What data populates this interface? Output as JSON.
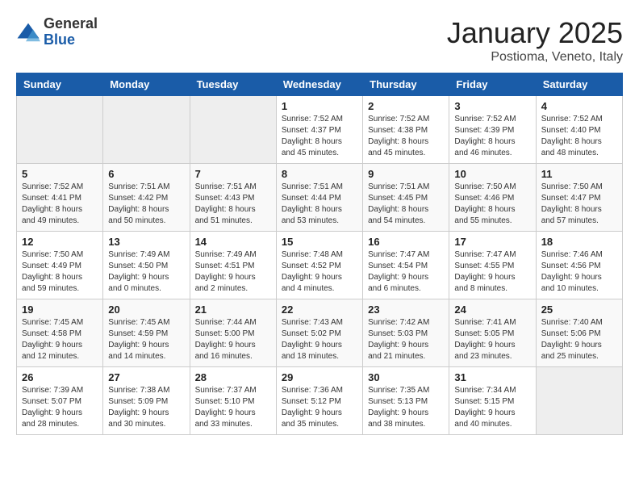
{
  "logo": {
    "general": "General",
    "blue": "Blue"
  },
  "header": {
    "title": "January 2025",
    "subtitle": "Postioma, Veneto, Italy"
  },
  "weekdays": [
    "Sunday",
    "Monday",
    "Tuesday",
    "Wednesday",
    "Thursday",
    "Friday",
    "Saturday"
  ],
  "weeks": [
    [
      {
        "day": "",
        "empty": true
      },
      {
        "day": "",
        "empty": true
      },
      {
        "day": "",
        "empty": true
      },
      {
        "day": "1",
        "sunrise": "Sunrise: 7:52 AM",
        "sunset": "Sunset: 4:37 PM",
        "daylight": "Daylight: 8 hours and 45 minutes."
      },
      {
        "day": "2",
        "sunrise": "Sunrise: 7:52 AM",
        "sunset": "Sunset: 4:38 PM",
        "daylight": "Daylight: 8 hours and 45 minutes."
      },
      {
        "day": "3",
        "sunrise": "Sunrise: 7:52 AM",
        "sunset": "Sunset: 4:39 PM",
        "daylight": "Daylight: 8 hours and 46 minutes."
      },
      {
        "day": "4",
        "sunrise": "Sunrise: 7:52 AM",
        "sunset": "Sunset: 4:40 PM",
        "daylight": "Daylight: 8 hours and 48 minutes."
      }
    ],
    [
      {
        "day": "5",
        "sunrise": "Sunrise: 7:52 AM",
        "sunset": "Sunset: 4:41 PM",
        "daylight": "Daylight: 8 hours and 49 minutes."
      },
      {
        "day": "6",
        "sunrise": "Sunrise: 7:51 AM",
        "sunset": "Sunset: 4:42 PM",
        "daylight": "Daylight: 8 hours and 50 minutes."
      },
      {
        "day": "7",
        "sunrise": "Sunrise: 7:51 AM",
        "sunset": "Sunset: 4:43 PM",
        "daylight": "Daylight: 8 hours and 51 minutes."
      },
      {
        "day": "8",
        "sunrise": "Sunrise: 7:51 AM",
        "sunset": "Sunset: 4:44 PM",
        "daylight": "Daylight: 8 hours and 53 minutes."
      },
      {
        "day": "9",
        "sunrise": "Sunrise: 7:51 AM",
        "sunset": "Sunset: 4:45 PM",
        "daylight": "Daylight: 8 hours and 54 minutes."
      },
      {
        "day": "10",
        "sunrise": "Sunrise: 7:50 AM",
        "sunset": "Sunset: 4:46 PM",
        "daylight": "Daylight: 8 hours and 55 minutes."
      },
      {
        "day": "11",
        "sunrise": "Sunrise: 7:50 AM",
        "sunset": "Sunset: 4:47 PM",
        "daylight": "Daylight: 8 hours and 57 minutes."
      }
    ],
    [
      {
        "day": "12",
        "sunrise": "Sunrise: 7:50 AM",
        "sunset": "Sunset: 4:49 PM",
        "daylight": "Daylight: 8 hours and 59 minutes."
      },
      {
        "day": "13",
        "sunrise": "Sunrise: 7:49 AM",
        "sunset": "Sunset: 4:50 PM",
        "daylight": "Daylight: 9 hours and 0 minutes."
      },
      {
        "day": "14",
        "sunrise": "Sunrise: 7:49 AM",
        "sunset": "Sunset: 4:51 PM",
        "daylight": "Daylight: 9 hours and 2 minutes."
      },
      {
        "day": "15",
        "sunrise": "Sunrise: 7:48 AM",
        "sunset": "Sunset: 4:52 PM",
        "daylight": "Daylight: 9 hours and 4 minutes."
      },
      {
        "day": "16",
        "sunrise": "Sunrise: 7:47 AM",
        "sunset": "Sunset: 4:54 PM",
        "daylight": "Daylight: 9 hours and 6 minutes."
      },
      {
        "day": "17",
        "sunrise": "Sunrise: 7:47 AM",
        "sunset": "Sunset: 4:55 PM",
        "daylight": "Daylight: 9 hours and 8 minutes."
      },
      {
        "day": "18",
        "sunrise": "Sunrise: 7:46 AM",
        "sunset": "Sunset: 4:56 PM",
        "daylight": "Daylight: 9 hours and 10 minutes."
      }
    ],
    [
      {
        "day": "19",
        "sunrise": "Sunrise: 7:45 AM",
        "sunset": "Sunset: 4:58 PM",
        "daylight": "Daylight: 9 hours and 12 minutes."
      },
      {
        "day": "20",
        "sunrise": "Sunrise: 7:45 AM",
        "sunset": "Sunset: 4:59 PM",
        "daylight": "Daylight: 9 hours and 14 minutes."
      },
      {
        "day": "21",
        "sunrise": "Sunrise: 7:44 AM",
        "sunset": "Sunset: 5:00 PM",
        "daylight": "Daylight: 9 hours and 16 minutes."
      },
      {
        "day": "22",
        "sunrise": "Sunrise: 7:43 AM",
        "sunset": "Sunset: 5:02 PM",
        "daylight": "Daylight: 9 hours and 18 minutes."
      },
      {
        "day": "23",
        "sunrise": "Sunrise: 7:42 AM",
        "sunset": "Sunset: 5:03 PM",
        "daylight": "Daylight: 9 hours and 21 minutes."
      },
      {
        "day": "24",
        "sunrise": "Sunrise: 7:41 AM",
        "sunset": "Sunset: 5:05 PM",
        "daylight": "Daylight: 9 hours and 23 minutes."
      },
      {
        "day": "25",
        "sunrise": "Sunrise: 7:40 AM",
        "sunset": "Sunset: 5:06 PM",
        "daylight": "Daylight: 9 hours and 25 minutes."
      }
    ],
    [
      {
        "day": "26",
        "sunrise": "Sunrise: 7:39 AM",
        "sunset": "Sunset: 5:07 PM",
        "daylight": "Daylight: 9 hours and 28 minutes."
      },
      {
        "day": "27",
        "sunrise": "Sunrise: 7:38 AM",
        "sunset": "Sunset: 5:09 PM",
        "daylight": "Daylight: 9 hours and 30 minutes."
      },
      {
        "day": "28",
        "sunrise": "Sunrise: 7:37 AM",
        "sunset": "Sunset: 5:10 PM",
        "daylight": "Daylight: 9 hours and 33 minutes."
      },
      {
        "day": "29",
        "sunrise": "Sunrise: 7:36 AM",
        "sunset": "Sunset: 5:12 PM",
        "daylight": "Daylight: 9 hours and 35 minutes."
      },
      {
        "day": "30",
        "sunrise": "Sunrise: 7:35 AM",
        "sunset": "Sunset: 5:13 PM",
        "daylight": "Daylight: 9 hours and 38 minutes."
      },
      {
        "day": "31",
        "sunrise": "Sunrise: 7:34 AM",
        "sunset": "Sunset: 5:15 PM",
        "daylight": "Daylight: 9 hours and 40 minutes."
      },
      {
        "day": "",
        "empty": true
      }
    ]
  ]
}
